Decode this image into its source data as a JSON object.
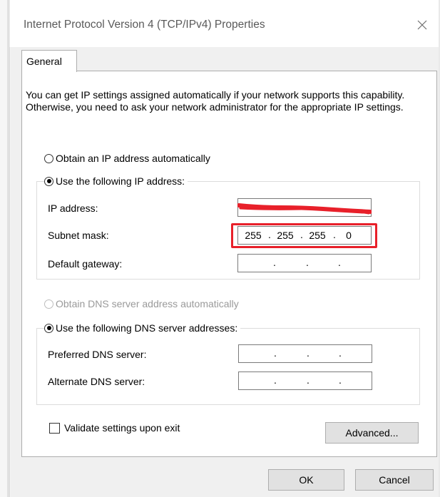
{
  "window": {
    "title": "Internet Protocol Version 4 (TCP/IPv4) Properties"
  },
  "tabs": [
    {
      "label": "General",
      "selected": true
    }
  ],
  "description": "You can get IP settings assigned automatically if your network supports this capability. Otherwise, you need to ask your network administrator for the appropriate IP settings.",
  "ip_section": {
    "obtain_auto_label": "Obtain an IP address automatically",
    "use_following_label": "Use the following IP address:",
    "selected": "use_following",
    "fields": [
      {
        "label": "IP address:",
        "octets": [
          "",
          "",
          "",
          ""
        ],
        "redacted": true
      },
      {
        "label": "Subnet mask:",
        "octets": [
          "255",
          "255",
          "255",
          "0"
        ],
        "highlighted": true
      },
      {
        "label": "Default gateway:",
        "octets": [
          "",
          "",
          "",
          ""
        ]
      }
    ]
  },
  "dns_section": {
    "obtain_auto_label": "Obtain DNS server address automatically",
    "obtain_auto_disabled": true,
    "use_following_label": "Use the following DNS server addresses:",
    "selected": "use_following",
    "fields": [
      {
        "label": "Preferred DNS server:",
        "octets": [
          "",
          "",
          "",
          ""
        ]
      },
      {
        "label": "Alternate DNS server:",
        "octets": [
          "",
          "",
          "",
          ""
        ]
      }
    ]
  },
  "validate_checkbox": {
    "label": "Validate settings upon exit",
    "checked": false
  },
  "buttons": {
    "advanced": "Advanced...",
    "ok": "OK",
    "cancel": "Cancel"
  },
  "icons": {
    "close": "close-icon"
  },
  "colors": {
    "highlight": "#e8202a",
    "redaction": "#e8202a",
    "dialog_bg": "#f0f0f0"
  }
}
